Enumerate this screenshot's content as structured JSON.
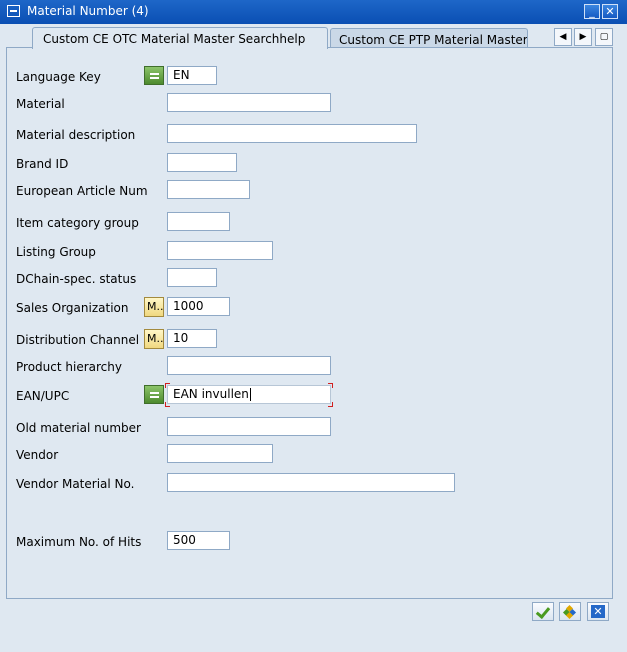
{
  "window": {
    "title": "Material Number (4)",
    "minimize_glyph": "_",
    "close_glyph": "✕"
  },
  "tabs": [
    {
      "label": "Custom CE OTC Material Master Searchhelp",
      "active": true
    },
    {
      "label": "Custom CE PTP Material Master ...",
      "active": false
    }
  ],
  "tab_nav": {
    "left_glyph": "◀",
    "right_glyph": "▶",
    "list_glyph": "▢"
  },
  "form": {
    "language_key": {
      "label": "Language Key",
      "value": "EN"
    },
    "material": {
      "label": "Material",
      "value": ""
    },
    "material_description": {
      "label": "Material description",
      "value": ""
    },
    "brand_id": {
      "label": "Brand ID",
      "value": ""
    },
    "european_article_num": {
      "label": "European Article Num",
      "value": ""
    },
    "item_category_group": {
      "label": "Item category group",
      "value": ""
    },
    "listing_group": {
      "label": "Listing Group",
      "value": ""
    },
    "dchain_status": {
      "label": "DChain-spec. status",
      "value": ""
    },
    "sales_organization": {
      "label": "Sales Organization",
      "value": "1000",
      "button": "M..."
    },
    "distribution_channel": {
      "label": "Distribution Channel",
      "value": "10",
      "button": "M..."
    },
    "product_hierarchy": {
      "label": "Product hierarchy",
      "value": ""
    },
    "ean_upc": {
      "label": "EAN/UPC",
      "value": "EAN invullen"
    },
    "old_material_number": {
      "label": "Old material number",
      "value": ""
    },
    "vendor": {
      "label": "Vendor",
      "value": ""
    },
    "vendor_material_no": {
      "label": "Vendor Material No.",
      "value": ""
    },
    "max_hits": {
      "label": "Maximum No. of Hits",
      "value": "500"
    }
  },
  "footer": {
    "cancel_glyph": "✕"
  },
  "colors": {
    "title_bar": "#0a4fb3",
    "background": "#dfe8f1",
    "border": "#8fa9c6",
    "check_green": "#4a9a1f",
    "cancel_blue": "#2468c8",
    "focus_corner": "#d02020"
  }
}
